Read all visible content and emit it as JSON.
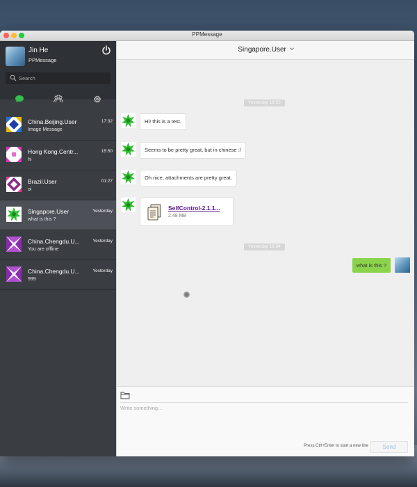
{
  "window": {
    "title": "PPMessage",
    "colors": {
      "sidebar": "#3a3d42",
      "sidebar_active": "#4d5157",
      "accent_green": "#2fbf4a",
      "outgoing_bubble": "#8bd34a",
      "file_link": "#5a1a8a"
    }
  },
  "profile": {
    "name": "Jin He",
    "app": "PPMessage",
    "power_icon": "power-icon"
  },
  "search": {
    "placeholder": "Search"
  },
  "nav": {
    "tabs": [
      {
        "icon": "chat-bubble-icon",
        "active": true
      },
      {
        "icon": "contacts-icon",
        "active": false
      },
      {
        "icon": "gear-icon",
        "active": false
      }
    ]
  },
  "conversations": [
    {
      "name": "China.Beijing.User",
      "preview": "Image Message",
      "time": "17:32"
    },
    {
      "name": "Hong Kong.Centr...",
      "preview": "hi",
      "time": "15:50"
    },
    {
      "name": "Brazil.User",
      "preview": "oi",
      "time": "01:27"
    },
    {
      "name": "Singapore.User",
      "preview": "what is this ?",
      "time": "Yesterday",
      "active": true
    },
    {
      "name": "China.Chengdu.U...",
      "preview": "You are offline",
      "time": "Yesterday"
    },
    {
      "name": "China.Chengdu.U...",
      "preview": "999",
      "time": "Yesterday"
    }
  ],
  "chat": {
    "title": "Singapore.User",
    "dividers": [
      "Yesterday 19:53",
      "Yesterday 19:54"
    ],
    "messages": [
      {
        "text": "Hi! this is a test."
      },
      {
        "text": "Seems to be pretty great, but in chinese :/"
      },
      {
        "text": "Oh nice, attachments are pretty great."
      }
    ],
    "file": {
      "name": "SelfControl-2.1.1...",
      "size": "2.48 MB"
    },
    "outgoing": {
      "text": "what is this ?"
    }
  },
  "composer": {
    "placeholder": "Write something...",
    "hint": "Press Ctrl+Enter to start a new line",
    "send_label": "Send"
  }
}
